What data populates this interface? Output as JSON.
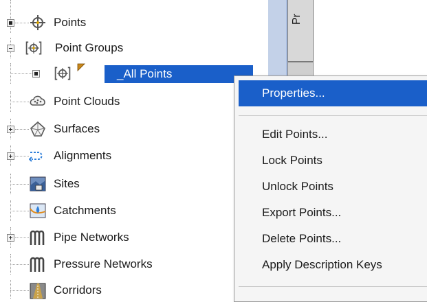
{
  "tree": {
    "items": [
      {
        "label": "Points",
        "expander": "bullet",
        "icon": "points-icon"
      },
      {
        "label": "Point Groups",
        "expander": "minus",
        "icon": "point-groups-icon"
      },
      {
        "label": "_All Points",
        "expander": "bullet",
        "icon": "point-group-icon",
        "selected": true
      },
      {
        "label": "Point Clouds",
        "expander": "none",
        "icon": "point-clouds-icon"
      },
      {
        "label": "Surfaces",
        "expander": "plus",
        "icon": "surfaces-icon"
      },
      {
        "label": "Alignments",
        "expander": "plus",
        "icon": "alignments-icon"
      },
      {
        "label": "Sites",
        "expander": "none",
        "icon": "sites-icon"
      },
      {
        "label": "Catchments",
        "expander": "none",
        "icon": "catchments-icon"
      },
      {
        "label": "Pipe Networks",
        "expander": "plus",
        "icon": "pipe-networks-icon"
      },
      {
        "label": "Pressure Networks",
        "expander": "none",
        "icon": "pressure-networks-icon"
      },
      {
        "label": "Corridors",
        "expander": "none",
        "icon": "corridors-icon"
      }
    ]
  },
  "side_tab": {
    "label": "Pr"
  },
  "context_menu": {
    "items": [
      {
        "label": "Properties..."
      },
      {
        "label": "Edit Points..."
      },
      {
        "label": "Lock Points"
      },
      {
        "label": "Unlock Points"
      },
      {
        "label": "Export Points..."
      },
      {
        "label": "Delete Points..."
      },
      {
        "label": "Apply Description Keys"
      }
    ]
  },
  "colors": {
    "selection": "#1a5fc9",
    "menu_bg": "#f5f5f5",
    "panel": "#c3d1e8"
  }
}
